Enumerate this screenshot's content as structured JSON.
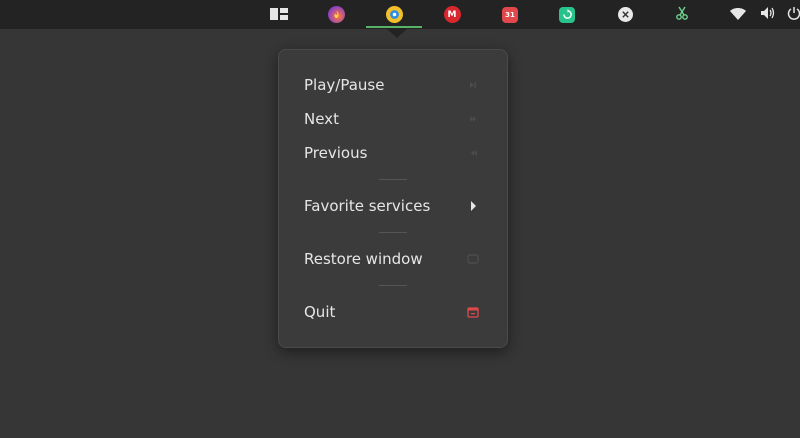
{
  "panel": {
    "apps": [
      {
        "name": "workspaces",
        "icon": "workspaces-grid-icon"
      },
      {
        "name": "firefox",
        "icon": "firefox-icon",
        "color": "#8a3fc4"
      },
      {
        "name": "nuclear",
        "icon": "music-player-icon",
        "color": "#f3c02b"
      },
      {
        "name": "mega",
        "icon": "mega-icon",
        "color": "#d9272e",
        "glyph": "M"
      },
      {
        "name": "calendar",
        "icon": "calendar-icon",
        "color": "#e0484c",
        "glyph": "31"
      },
      {
        "name": "sync",
        "icon": "sync-icon",
        "color": "#28c28b"
      },
      {
        "name": "circle",
        "icon": "circle-icon",
        "color": "#e8e8e8"
      },
      {
        "name": "scissors",
        "icon": "scissors-icon",
        "color": "#6fd38f"
      },
      {
        "name": "wifi",
        "icon": "wifi-icon"
      },
      {
        "name": "volume",
        "icon": "volume-icon"
      },
      {
        "name": "power",
        "icon": "power-icon"
      }
    ],
    "active_indicator_color": "#58b368"
  },
  "menu": {
    "items": [
      {
        "label": "Play/Pause",
        "icon": "play-pause-icon"
      },
      {
        "label": "Next",
        "icon": "next-icon"
      },
      {
        "label": "Previous",
        "icon": "previous-icon"
      },
      {
        "label": "Favorite services",
        "icon": "submenu-arrow-icon"
      },
      {
        "label": "Restore window",
        "icon": "restore-window-icon"
      },
      {
        "label": "Quit",
        "icon": "quit-icon",
        "icon_color": "#e0484c"
      }
    ]
  }
}
